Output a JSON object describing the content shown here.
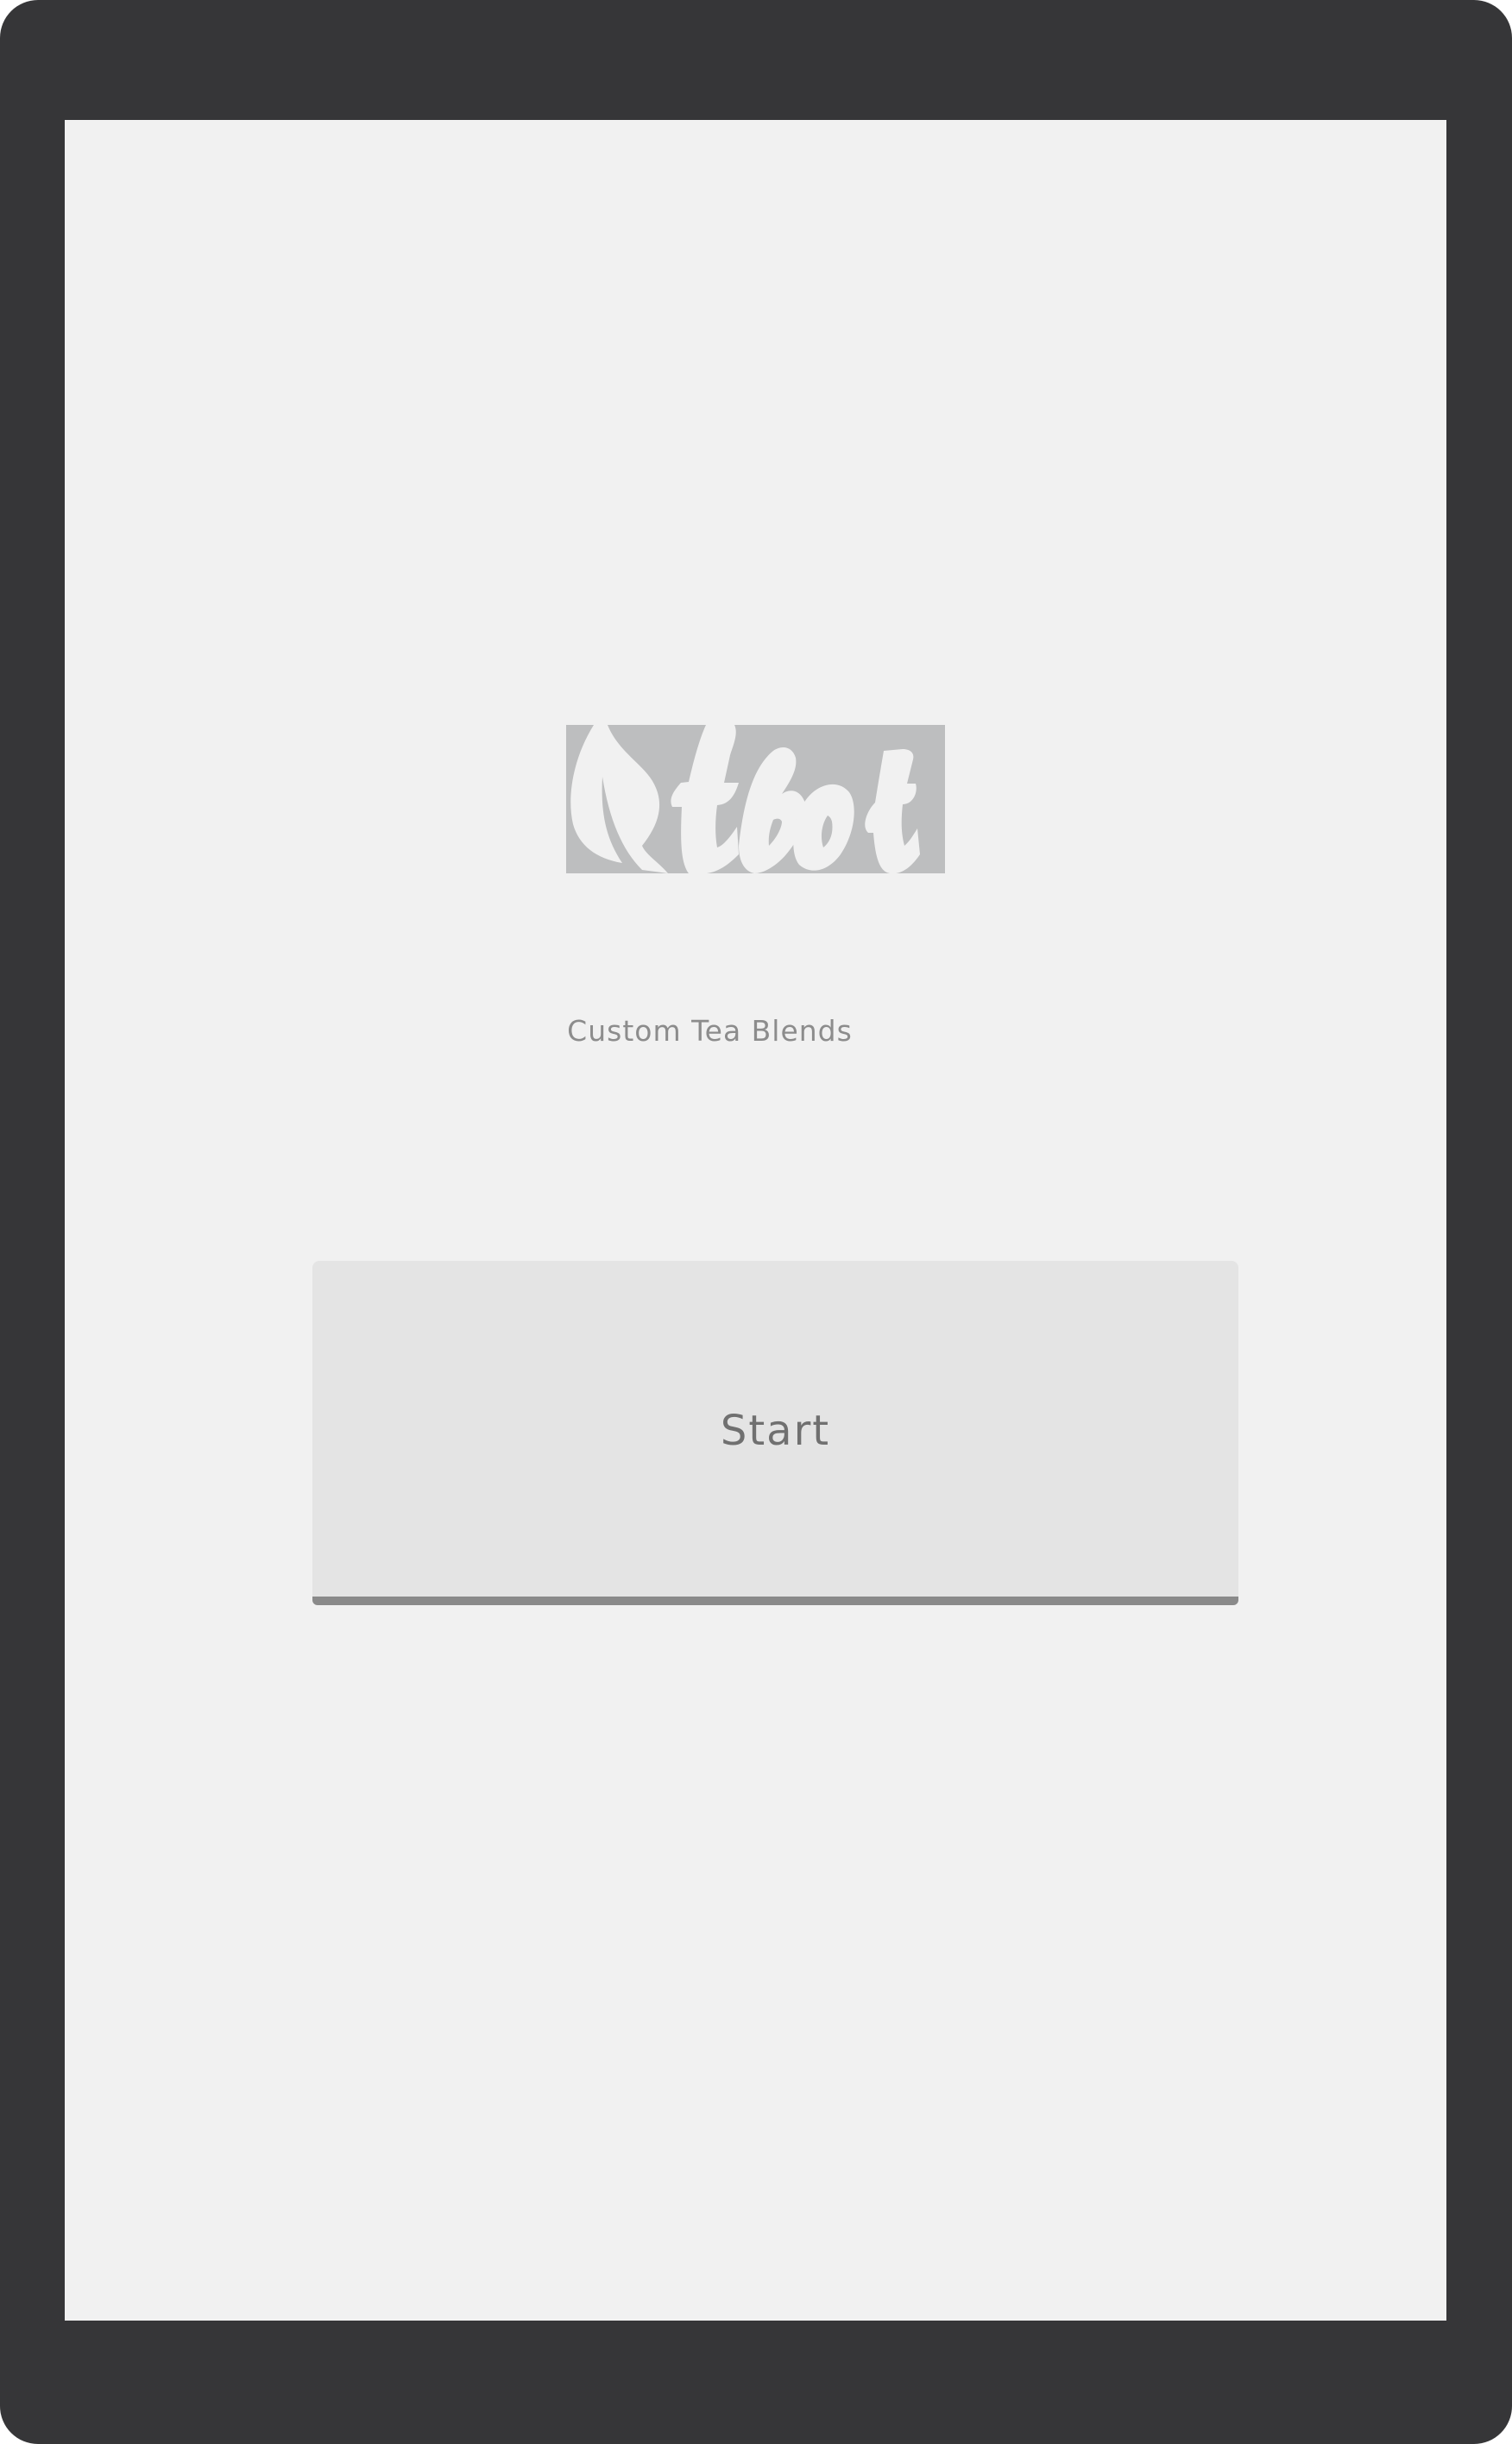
{
  "logo": {
    "text": "tbot",
    "icon": "tea-leaf-icon",
    "background_color": "#bdbebf",
    "foreground_color": "#f1f1f1"
  },
  "tagline": "Custom Tea Blends",
  "start_button": {
    "label": "Start"
  },
  "colors": {
    "device_frame": "#363638",
    "screen_background": "#f1f1f1",
    "button_background": "#e4e4e4",
    "button_shadow": "#8a8a8a",
    "text_muted": "#8c8c8c"
  }
}
